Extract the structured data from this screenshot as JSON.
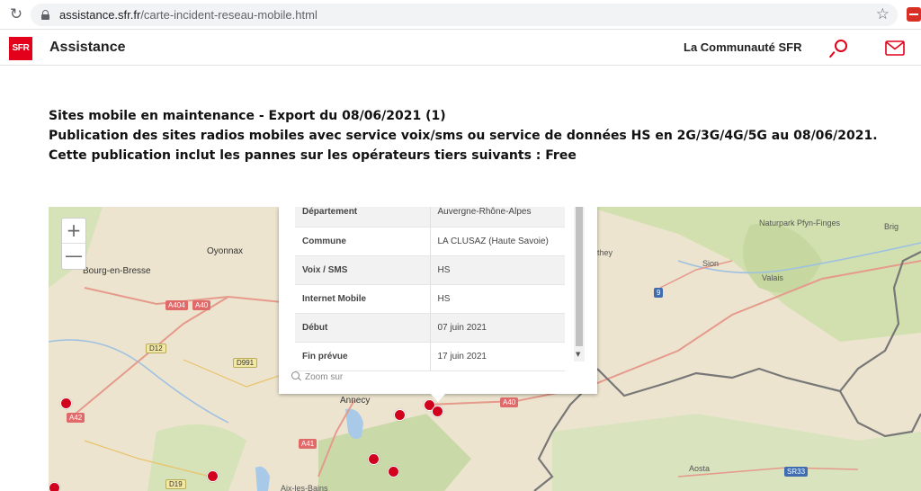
{
  "browser": {
    "url_host": "assistance.sfr.fr",
    "url_path": "/carte-incident-reseau-mobile.html",
    "icons": [
      "reload-icon",
      "lock-icon",
      "star-icon",
      "extension-icon"
    ]
  },
  "header": {
    "logo_text": "SFR",
    "title": "Assistance",
    "community_link": "La Communauté SFR",
    "brand_color": "#e2001a",
    "icons": [
      "search-icon",
      "mail-icon"
    ]
  },
  "intro": {
    "title": "Sites mobile en maintenance - Export du 08/06/2021 (1)",
    "description": "Publication des sites radios mobiles avec service voix/sms ou service de données HS en 2G/3G/4G/5G au 08/06/2021. Cette publication inclut les pannes sur les opérateurs tiers suivants : Free"
  },
  "map": {
    "zoom_in": "+",
    "zoom_out": "—",
    "labels": {
      "oyonnax": "Oyonnax",
      "bourg": "Bourg-en-Bresse",
      "annecy": "Annecy",
      "aix": "Aix-les-Bains",
      "they": "they",
      "sion": "Sion",
      "valais": "Valais",
      "brig": "Brig",
      "park": "Naturpark Pfyn-Finges",
      "aosta": "Aosta"
    },
    "roads": {
      "a404": "A404",
      "a40": "A40",
      "d12": "D12",
      "d991": "D991",
      "a42": "A42",
      "a41": "A41",
      "d19": "D19",
      "a40b": "A40",
      "r9": "9",
      "sr33": "SR33"
    },
    "marker_color": "#d1001c",
    "popup": {
      "rows": [
        {
          "key": "Département",
          "value": "Auvergne-Rhône-Alpes"
        },
        {
          "key": "Commune",
          "value": "LA CLUSAZ (Haute Savoie)"
        },
        {
          "key": "Voix / SMS",
          "value": "HS"
        },
        {
          "key": "Internet Mobile",
          "value": "HS"
        },
        {
          "key": "Début",
          "value": "07 juin 2021"
        },
        {
          "key": "Fin prévue",
          "value": "17 juin 2021"
        }
      ],
      "zoom_link": "Zoom sur"
    }
  }
}
